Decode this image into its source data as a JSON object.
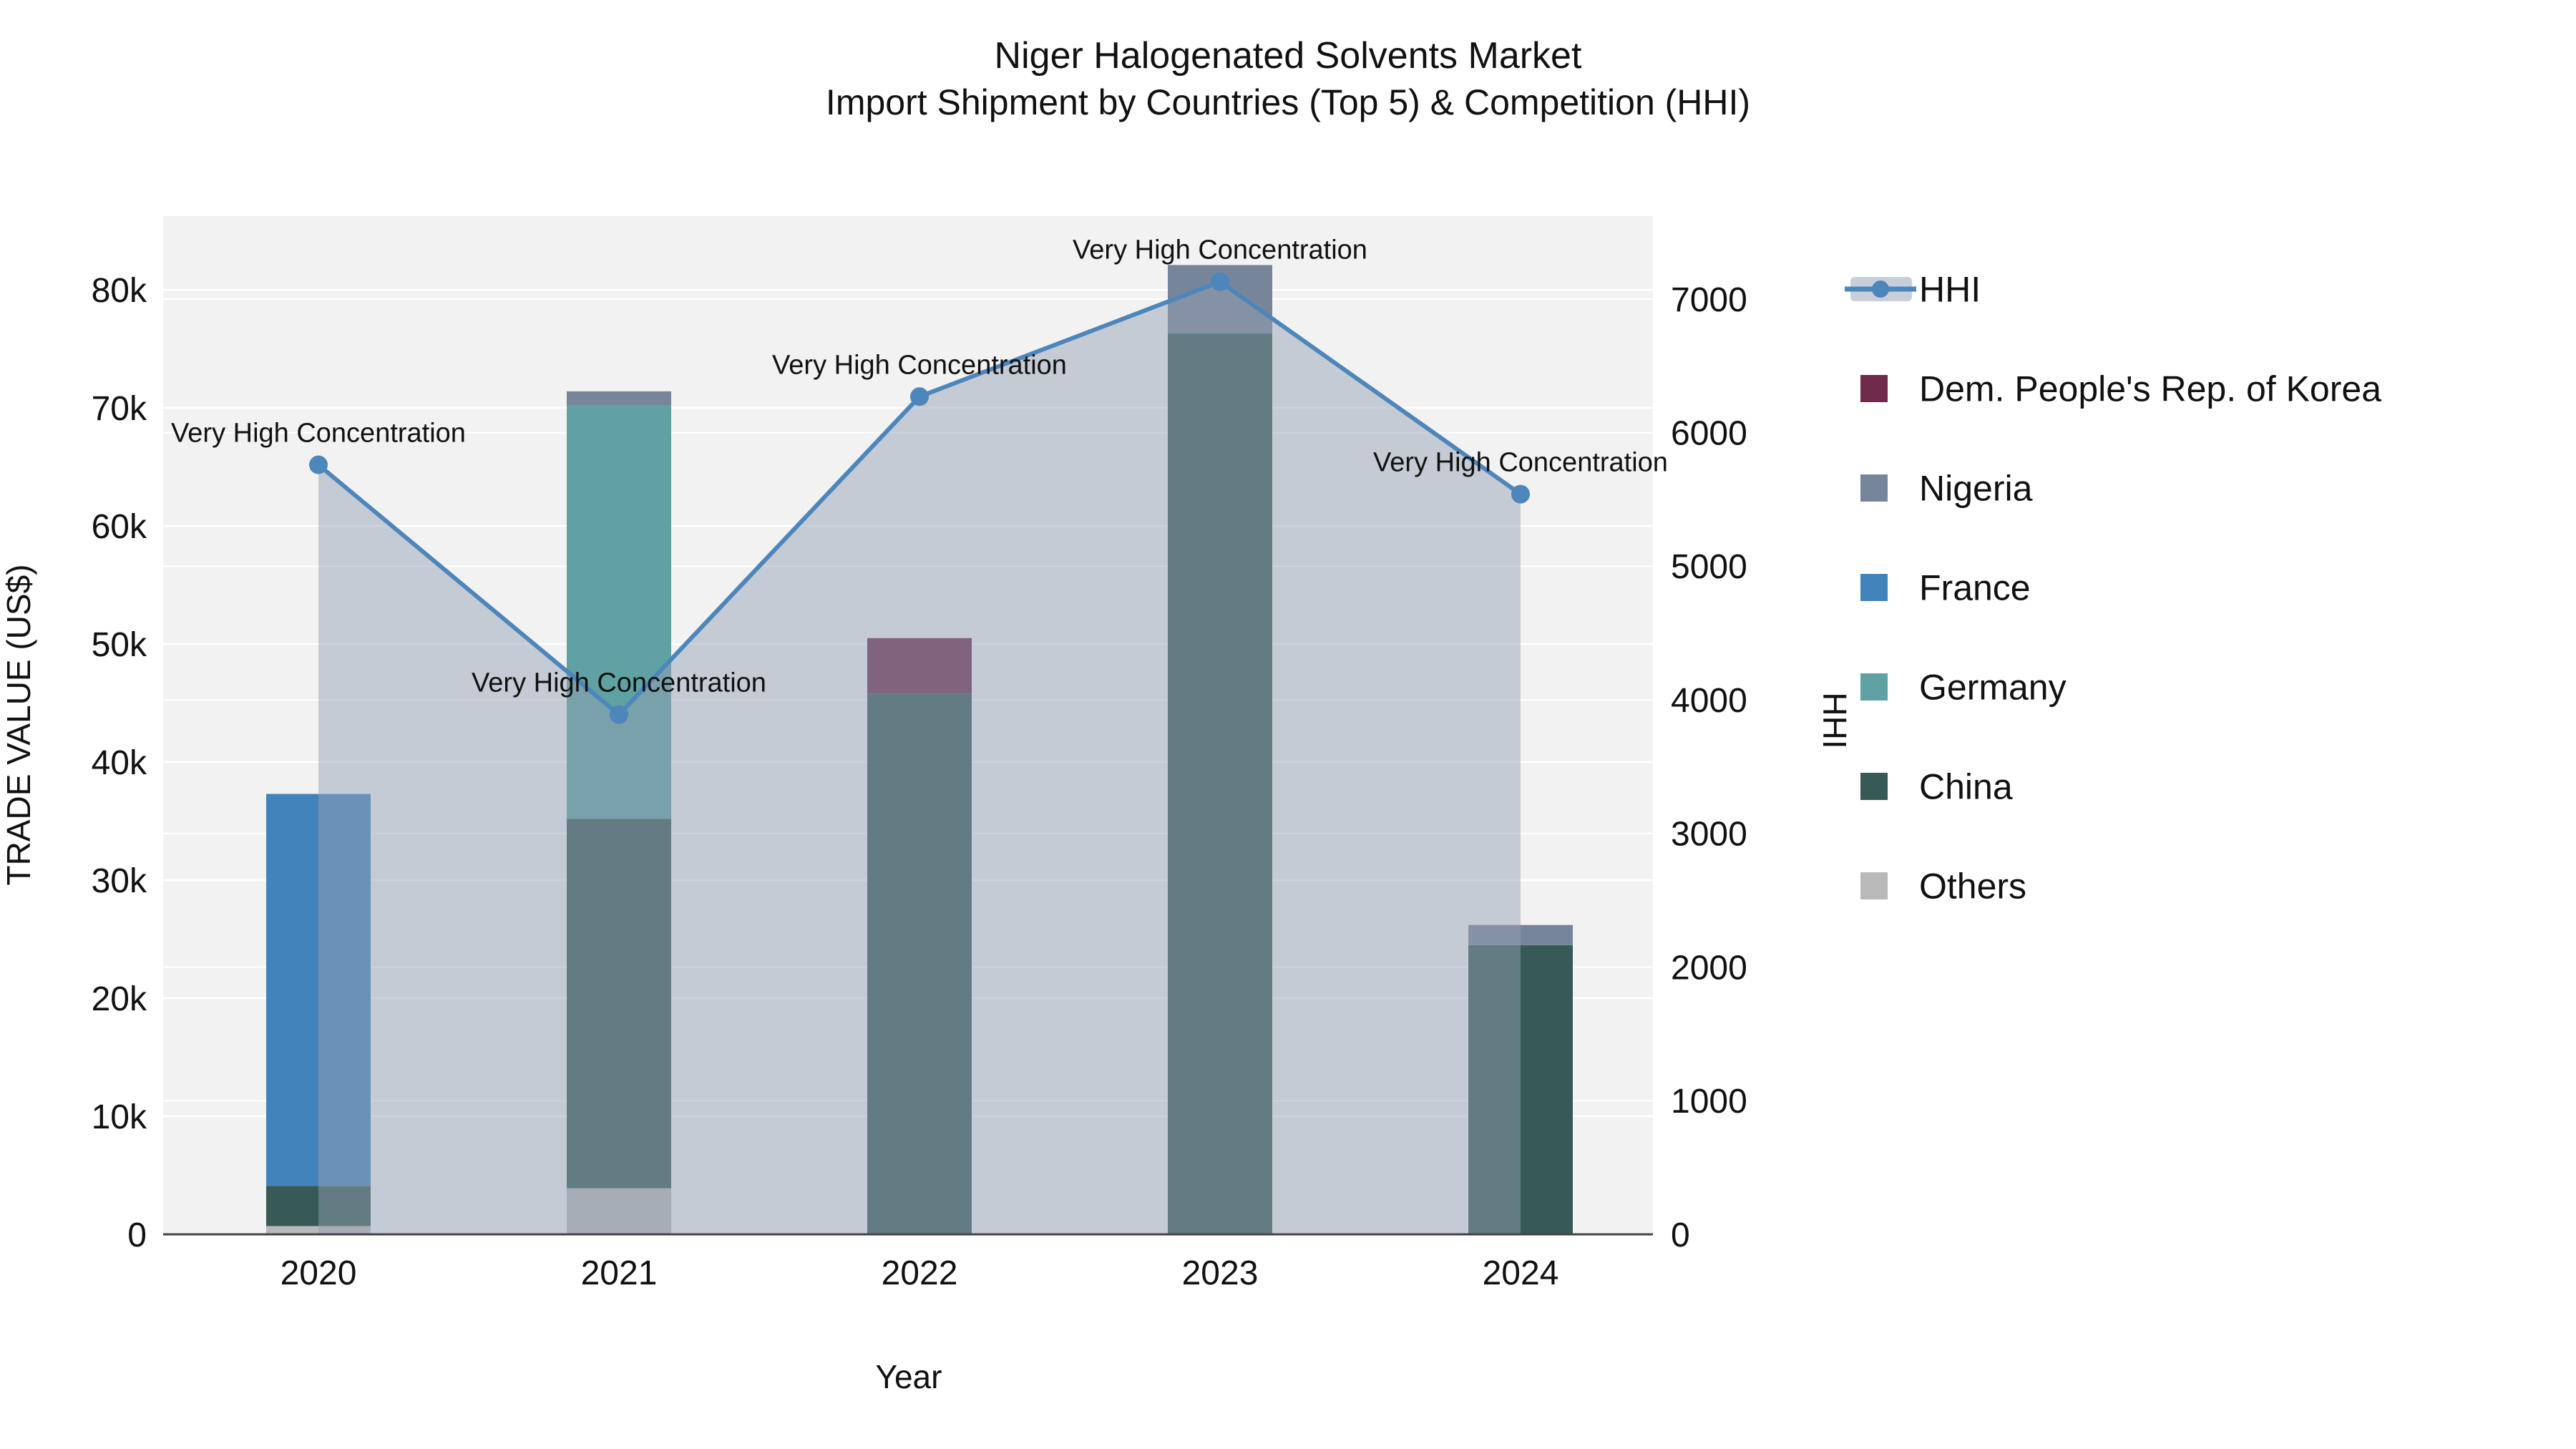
{
  "title": {
    "line1": "Niger Halogenated Solvents Market",
    "line2": "Import Shipment by Countries (Top 5) & Competition (HHI)"
  },
  "axes": {
    "x": {
      "title": "Year",
      "ticks": [
        "2020",
        "2021",
        "2022",
        "2023",
        "2024"
      ]
    },
    "left": {
      "title": "TRADE VALUE (US$)",
      "ticks": [
        "0",
        "10k",
        "20k",
        "30k",
        "40k",
        "50k",
        "60k",
        "70k",
        "80k"
      ],
      "tick_step": 10000,
      "max": 86500
    },
    "right": {
      "title": "HHI",
      "ticks": [
        "0",
        "1000",
        "2000",
        "3000",
        "4000",
        "5000",
        "6000",
        "7000"
      ],
      "tick_step": 1000,
      "max": 7610
    }
  },
  "legend": {
    "items": [
      {
        "label": "HHI",
        "type": "line",
        "color": "#4d86bb",
        "band": "#c9cfda"
      },
      {
        "label": "Dem. People's Rep. of Korea",
        "type": "square",
        "color": "#6e2b4c"
      },
      {
        "label": "Nigeria",
        "type": "square",
        "color": "#77859a"
      },
      {
        "label": "France",
        "type": "square",
        "color": "#4383bb"
      },
      {
        "label": "Germany",
        "type": "square",
        "color": "#60a2a4"
      },
      {
        "label": "China",
        "type": "square",
        "color": "#375a56"
      },
      {
        "label": "Others",
        "type": "square",
        "color": "#b9b9b9"
      }
    ]
  },
  "chart_data": {
    "type": [
      "stacked-bar",
      "line"
    ],
    "categories": [
      "2020",
      "2021",
      "2022",
      "2023",
      "2024"
    ],
    "bar_axis": {
      "label": "TRADE VALUE (US$)",
      "range": [
        0,
        86500
      ],
      "unit": "US$"
    },
    "line_axis": {
      "label": "HHI",
      "range": [
        0,
        7610
      ]
    },
    "series": [
      {
        "name": "Others",
        "axis": "left",
        "color": "#b9b9b9",
        "values": [
          700,
          3900,
          0,
          0,
          0
        ]
      },
      {
        "name": "China",
        "axis": "left",
        "color": "#375a56",
        "values": [
          3400,
          31300,
          45800,
          76300,
          24500
        ]
      },
      {
        "name": "Germany",
        "axis": "left",
        "color": "#60a2a4",
        "values": [
          0,
          35000,
          0,
          0,
          0
        ]
      },
      {
        "name": "France",
        "axis": "left",
        "color": "#4383bb",
        "values": [
          33200,
          0,
          0,
          0,
          0
        ]
      },
      {
        "name": "Nigeria",
        "axis": "left",
        "color": "#77859a",
        "values": [
          0,
          1200,
          0,
          5800,
          1700
        ]
      },
      {
        "name": "Dem. People's Rep. of Korea",
        "axis": "left",
        "color": "#6e2b4c",
        "values": [
          0,
          0,
          4700,
          0,
          0
        ]
      }
    ],
    "bar_totals": [
      37300,
      71400,
      50500,
      82100,
      26200
    ],
    "hhi": {
      "name": "HHI",
      "axis": "right",
      "color": "#4d86bb",
      "area_fill": "rgba(148,160,179,0.48)",
      "values": [
        5760,
        3890,
        6270,
        7130,
        5540
      ]
    },
    "annotations": [
      {
        "text": "Very High Concentration",
        "category": "2020"
      },
      {
        "text": "Very High Concentration",
        "category": "2021"
      },
      {
        "text": "Very High Concentration",
        "category": "2022"
      },
      {
        "text": "Very High Concentration",
        "category": "2023"
      },
      {
        "text": "Very High Concentration",
        "category": "2024"
      }
    ],
    "grid": true,
    "legend_position": "right"
  },
  "colors": {
    "page_bg": "#ffffff",
    "plot_bg": "#f2f2f2",
    "grid": "#ffffff",
    "axis_line": "#444444",
    "text": "#111111"
  }
}
